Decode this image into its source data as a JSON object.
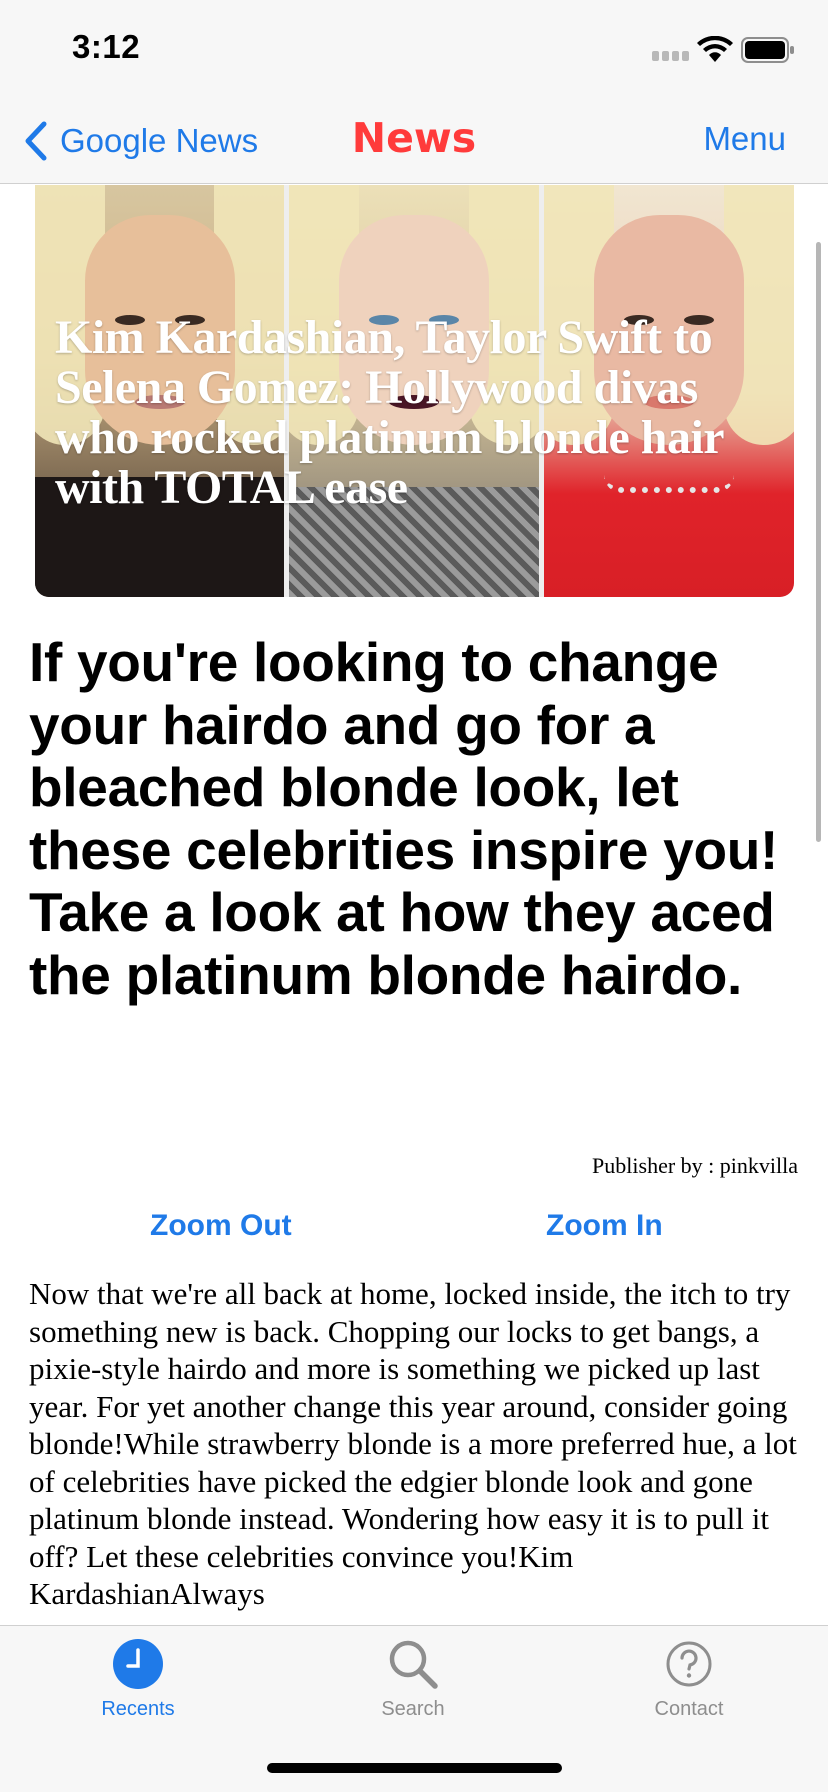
{
  "status_bar": {
    "time": "3:12",
    "icons": [
      "cellular-signal-icon",
      "wifi-icon",
      "battery-icon"
    ]
  },
  "nav": {
    "back_label": "Google News",
    "title": "News",
    "menu_label": "Menu"
  },
  "hero": {
    "caption": "Kim Kardashian, Taylor Swift to Selena Gomez: Hollywood divas who rocked platinum blonde hair with TOTAL ease",
    "panels": 3
  },
  "article": {
    "headline": "If you're looking to change your hairdo and go for a bleached blonde look, let these celebrities inspire you! Take a look at how they aced the platinum blonde hairdo.",
    "publisher": "Publisher by : pinkvilla",
    "zoom_out_label": "Zoom Out",
    "zoom_in_label": "Zoom In",
    "body": "Now that we're all back at home, locked inside, the itch to try something new is back. Chopping our locks to get bangs, a pixie-style hairdo and more is something we picked up last year. For yet another change this year around, consider going blonde!While strawberry blonde is a more preferred hue, a lot of celebrities have picked the edgier blonde look and gone platinum blonde instead. Wondering how easy it is to pull it off? Let these celebrities convince you!Kim KardashianAlways"
  },
  "tab_bar": {
    "tabs": [
      {
        "label": "Recents",
        "icon": "clock-icon",
        "active": true
      },
      {
        "label": "Search",
        "icon": "search-icon",
        "active": false
      },
      {
        "label": "Contact",
        "icon": "question-icon",
        "active": false
      }
    ]
  },
  "colors": {
    "accent": "#1f7ae8",
    "title_red": "#ff3b3b",
    "bar_background": "#f7f7f7"
  }
}
